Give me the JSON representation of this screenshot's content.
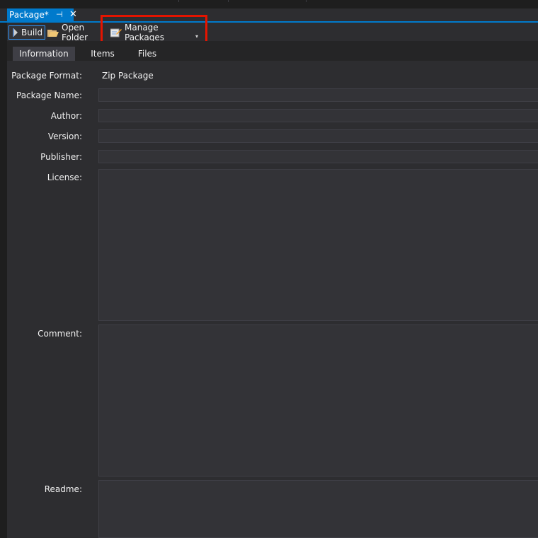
{
  "document_tab": {
    "title": "Package*",
    "pin_icon": "pin-icon",
    "close_icon": "close-icon"
  },
  "toolbar": {
    "build_label": "Build",
    "build_icon": "play-icon",
    "open_folder_label": "Open Folder",
    "open_folder_icon": "folder-open-icon",
    "manage_packages_label": "Manage Packages",
    "manage_packages_icon": "edit-icon",
    "overflow_icon": "chevron-down-icon"
  },
  "subtabs": [
    {
      "label": "Information",
      "active": true
    },
    {
      "label": "Items",
      "active": false
    },
    {
      "label": "Files",
      "active": false
    }
  ],
  "form": {
    "package_format": {
      "label": "Package Format:",
      "value": "Zip Package"
    },
    "package_name": {
      "label": "Package Name:",
      "value": ""
    },
    "author": {
      "label": "Author:",
      "value": ""
    },
    "version": {
      "label": "Version:",
      "value": ""
    },
    "publisher": {
      "label": "Publisher:",
      "value": ""
    },
    "license": {
      "label": "License:",
      "value": ""
    },
    "comment": {
      "label": "Comment:",
      "value": ""
    },
    "readme": {
      "label": "Readme:",
      "value": ""
    }
  },
  "colors": {
    "accent": "#007acc",
    "highlight": "#e51400",
    "background": "#2d2d30"
  }
}
